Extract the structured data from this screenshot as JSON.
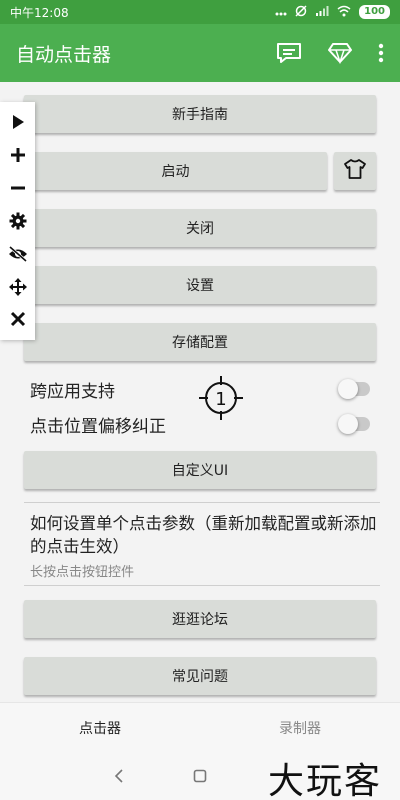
{
  "status_bar": {
    "time": "中午12:08",
    "battery": "100",
    "icons": [
      "dots-icon",
      "alarm-off-icon",
      "signal-icon",
      "wifi-icon",
      "battery-icon"
    ]
  },
  "app_bar": {
    "title": "自动点击器",
    "actions": [
      "chat-icon",
      "diamond-icon",
      "more-vert-icon"
    ]
  },
  "side_toolbar": {
    "items": [
      "play-icon",
      "plus-icon",
      "minus-icon",
      "gear-icon",
      "eye-off-icon",
      "move-icon",
      "close-icon"
    ]
  },
  "buttons": {
    "guide": "新手指南",
    "start": "启动",
    "stop": "关闭",
    "settings": "设置",
    "save_config": "存储配置",
    "custom_ui": "自定义UI",
    "forum": "逛逛论坛",
    "faq": "常见问题"
  },
  "toggles": {
    "cross_app": {
      "label": "跨应用支持",
      "on": false
    },
    "offset_fix": {
      "label": "点击位置偏移纠正",
      "on": false
    }
  },
  "target": {
    "number": "1"
  },
  "info": {
    "title": "如何设置单个点击参数（重新加载配置或新添加的点击生效）",
    "subtitle": "长按点击按钮控件"
  },
  "bottom_nav": {
    "clicker": "点击器",
    "recorder": "录制器"
  },
  "watermark": "大玩客",
  "colors": {
    "status_bar": "#3f9f3f",
    "app_bar": "#4caf50",
    "button": "#d9dcd8"
  }
}
